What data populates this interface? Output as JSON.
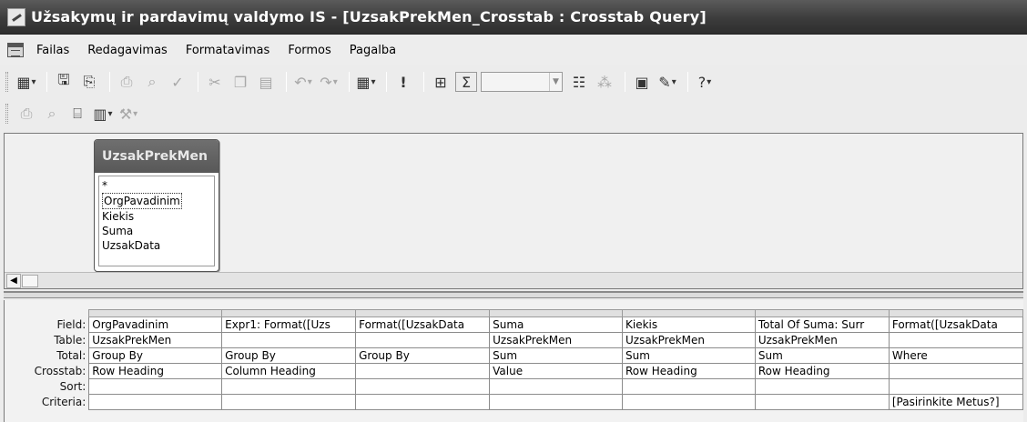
{
  "window": {
    "title": "Užsakymų ir pardavimų valdymo IS - [UzsakPrekMen_Crosstab : Crosstab Query]"
  },
  "menu": [
    "Failas",
    "Redagavimas",
    "Formatavimas",
    "Formos",
    "Pagalba"
  ],
  "toolbar1": {
    "buttons": [
      "view-icon",
      "save-icon",
      "find-icon",
      "print-icon",
      "print-preview-icon",
      "spelling-icon",
      "cut-icon",
      "copy-icon",
      "paste-icon",
      "undo-icon",
      "redo-icon",
      "query-type-icon",
      "run-icon",
      "show-table-icon",
      "totals-icon",
      "properties-icon",
      "build-icon",
      "database-window-icon",
      "new-object-icon",
      "help-icon"
    ],
    "top_values": ""
  },
  "toolbar2": {
    "buttons": [
      "print-icon",
      "search-icon",
      "file-search-icon",
      "grid-icon",
      "tools-icon"
    ]
  },
  "design": {
    "table": {
      "name": "UzsakPrekMen",
      "fields": [
        "*",
        "OrgPavadinim",
        "Kiekis",
        "Suma",
        "UzsakData"
      ]
    }
  },
  "grid": {
    "row_labels": [
      "Field:",
      "Table:",
      "Total:",
      "Crosstab:",
      "Sort:",
      "Criteria:"
    ],
    "columns": [
      {
        "field": "OrgPavadinim",
        "table": "UzsakPrekMen",
        "total": "Group By",
        "crosstab": "Row Heading",
        "sort": "",
        "criteria": ""
      },
      {
        "field": "Expr1: Format([Uzs",
        "table": "",
        "total": "Group By",
        "crosstab": "Column Heading",
        "sort": "",
        "criteria": ""
      },
      {
        "field": "Format([UzsakData",
        "table": "",
        "total": "Group By",
        "crosstab": "",
        "sort": "",
        "criteria": ""
      },
      {
        "field": "Suma",
        "table": "UzsakPrekMen",
        "total": "Sum",
        "crosstab": "Value",
        "sort": "",
        "criteria": ""
      },
      {
        "field": "Kiekis",
        "table": "UzsakPrekMen",
        "total": "Sum",
        "crosstab": "Row Heading",
        "sort": "",
        "criteria": ""
      },
      {
        "field": "Total Of Suma: Surr",
        "table": "UzsakPrekMen",
        "total": "Sum",
        "crosstab": "Row Heading",
        "sort": "",
        "criteria": ""
      },
      {
        "field": "Format([UzsakData",
        "table": "",
        "total": "Where",
        "crosstab": "",
        "sort": "",
        "criteria": "[Pasirinkite Metus?]"
      }
    ]
  }
}
